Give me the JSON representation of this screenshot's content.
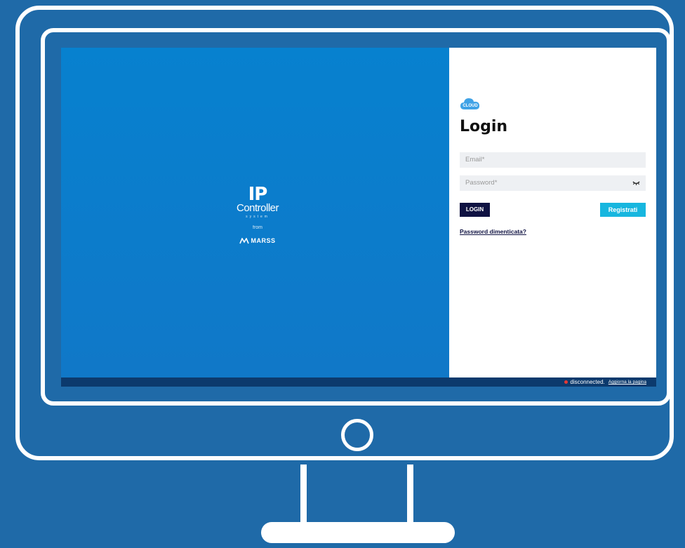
{
  "brand": {
    "logo_ip": "IP",
    "logo_controller": "Controller",
    "logo_system": "system",
    "logo_from": "from",
    "logo_marss": "MARSS"
  },
  "login": {
    "cloud_logo_text": "CLOUD",
    "title": "Login",
    "email_placeholder": "Email*",
    "password_placeholder": "Password*",
    "login_button": "LOGIN",
    "register_button": "Registrati",
    "forgot_link": "Password dimenticata?"
  },
  "status": {
    "state": "disconnected.",
    "reload_link": "Aggiorna la pagina",
    "dot_color": "#e53935"
  },
  "colors": {
    "background": "#1f6aa8",
    "left_panel": "#0781cf",
    "primary_button": "#0f1242",
    "register_button": "#17b6df",
    "status_bar": "#0c3a6d"
  }
}
